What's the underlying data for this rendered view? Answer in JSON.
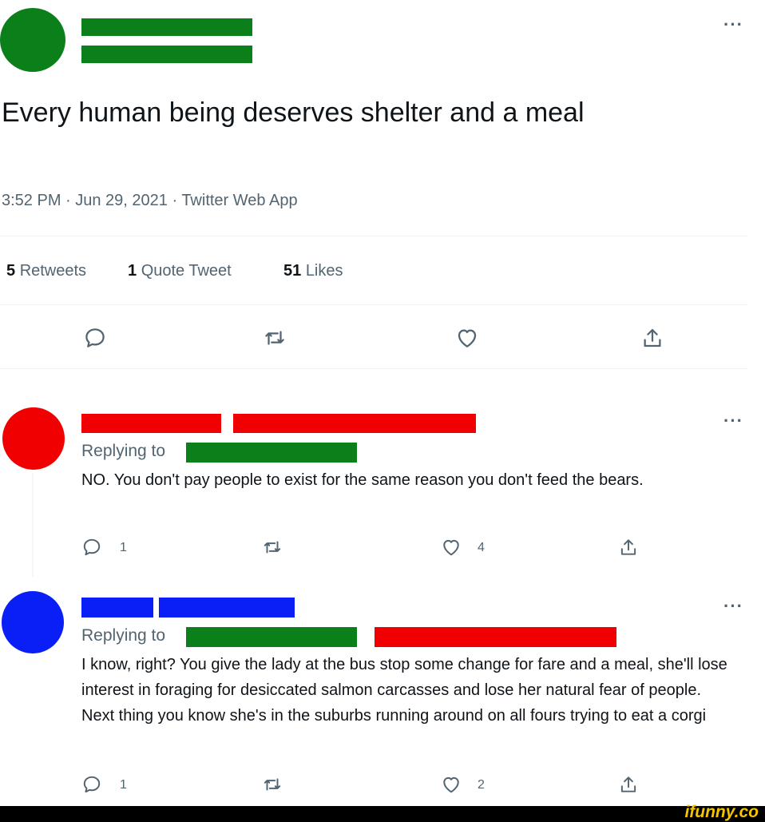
{
  "colors": {
    "green": "#0a7f1a",
    "red": "#f00000",
    "blue": "#0a1ff5",
    "brand": "#f5c400"
  },
  "main_tweet": {
    "text": "Every human being deserves shelter and a meal",
    "meta": "3:52 PM · Jun 29, 2021 · Twitter Web App",
    "stats": {
      "retweets_count": "5",
      "retweets_label": "Retweets",
      "quotes_count": "1",
      "quotes_label": "Quote Tweet",
      "likes_count": "51",
      "likes_label": "Likes"
    },
    "more_label": "···"
  },
  "reply1": {
    "replying_label": "Replying to",
    "text": "NO. You don't pay people to exist for the same reason you don't feed the bears.",
    "reply_count": "1",
    "like_count": "4",
    "more_label": "···"
  },
  "reply2": {
    "replying_label": "Replying to",
    "text": "I know, right? You give the lady at the bus stop some change for fare and a meal, she'll lose interest in foraging for desiccated salmon carcasses and lose her natural fear of people. Next thing you know she's in the suburbs running around on all fours trying to eat a corgi",
    "reply_count": "1",
    "like_count": "2",
    "more_label": "···"
  },
  "footer": {
    "brand": "ifunny.co"
  },
  "icons": [
    "reply-icon",
    "retweet-icon",
    "like-icon",
    "share-icon",
    "more-icon"
  ]
}
